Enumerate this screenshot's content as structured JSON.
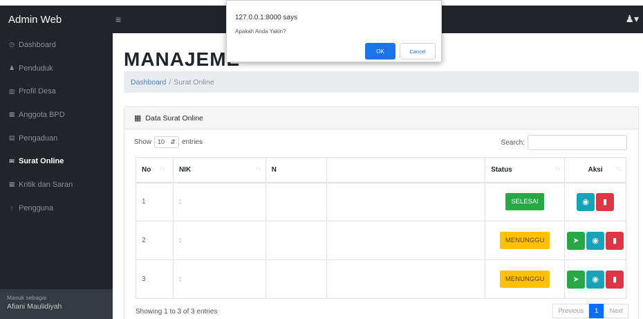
{
  "app": {
    "brand": "Admin Web",
    "menu_icon": "hamburger-icon",
    "user_icon": "user-icon"
  },
  "sidebar": {
    "items": [
      {
        "label": "Dashboard",
        "icon": "dashboard-icon",
        "glyph": "◷"
      },
      {
        "label": "Penduduk",
        "icon": "user-icon",
        "glyph": "♟"
      },
      {
        "label": "Profil Desa",
        "icon": "columns-icon",
        "glyph": "▥"
      },
      {
        "label": "Anggota BPD",
        "icon": "table-icon",
        "glyph": "▦"
      },
      {
        "label": "Pengaduan",
        "icon": "list-icon",
        "glyph": "▤"
      },
      {
        "label": "Surat Online",
        "icon": "envelope-icon",
        "glyph": "✉"
      },
      {
        "label": "Kritik dan Saran",
        "icon": "comments-icon",
        "glyph": "▦"
      },
      {
        "label": "Pengguna",
        "icon": "user-icon",
        "glyph": "⁞"
      }
    ],
    "footer_small": "Masuk sebagai",
    "footer_name": "Afiani Maulidiyah"
  },
  "main": {
    "title": "MANAJEME",
    "breadcrumb": {
      "link": "Dashboard",
      "separator": "/",
      "current": "Surat Online"
    },
    "card_title": "Data Surat Online",
    "show": "Show",
    "entries_value": "10",
    "entries": "entries",
    "search": "Search:",
    "columns": [
      "No",
      "NIK",
      "N",
      "",
      "Status",
      "Aksi"
    ],
    "sort_glyph": "↑↓",
    "rows": [
      {
        "no": "1",
        "nik": ":",
        "status": "SELESAI",
        "status_type": "success",
        "actions": [
          "view",
          "delete"
        ]
      },
      {
        "no": "2",
        "nik": ":",
        "status": "MENUNGGU",
        "status_type": "warning",
        "actions": [
          "send",
          "view",
          "delete"
        ]
      },
      {
        "no": "3",
        "nik": ":",
        "status": "MENUNGGU",
        "status_type": "warning",
        "actions": [
          "send",
          "view",
          "delete"
        ]
      }
    ],
    "info": "Showing 1 to 3 of 3 entries",
    "pagination": {
      "previous": "Previous",
      "page": "1",
      "next": "Next"
    }
  },
  "dialog": {
    "title": "127.0.0.1:8000 says",
    "message": "Apakah Anda Yakin?",
    "ok": "OK",
    "cancel": "Cancel"
  },
  "colors": {
    "sidebar_bg": "#212529",
    "success": "#28a745",
    "warning": "#ffc107",
    "info": "#17a2b8",
    "danger": "#dc3545",
    "dialog_ok": "#1a73e8"
  }
}
